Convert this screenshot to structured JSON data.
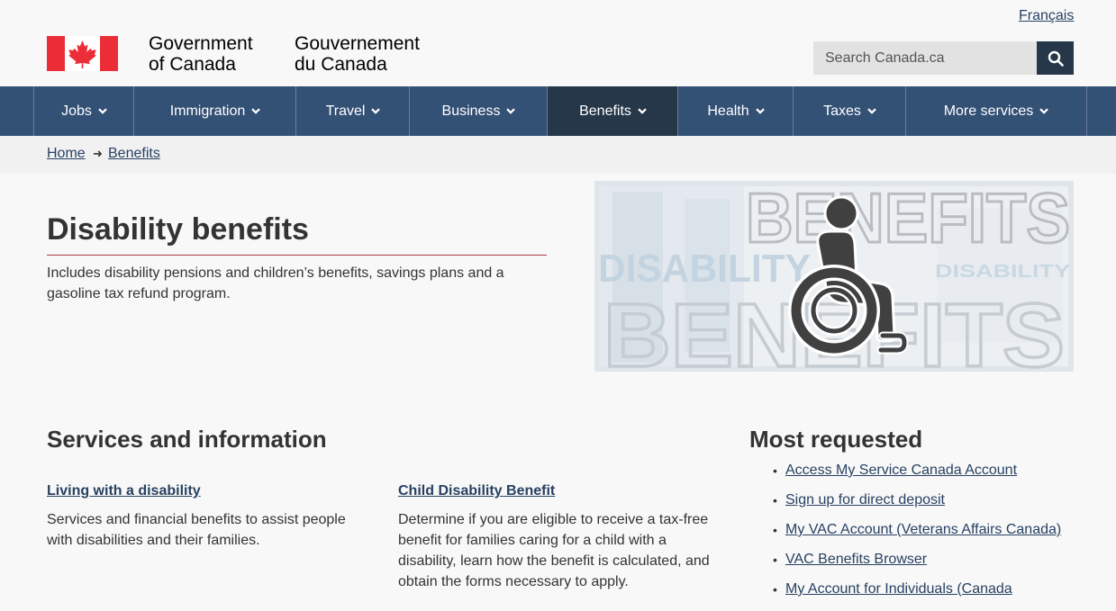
{
  "header": {
    "lang_link": "Français",
    "signature_en_line1": "Government",
    "signature_en_line2": "of Canada",
    "signature_fr_line1": "Gouvernement",
    "signature_fr_line2": "du Canada",
    "search_placeholder": "Search Canada.ca"
  },
  "menu": {
    "items": [
      {
        "label": "Jobs"
      },
      {
        "label": "Immigration"
      },
      {
        "label": "Travel"
      },
      {
        "label": "Business"
      },
      {
        "label": "Benefits"
      },
      {
        "label": "Health"
      },
      {
        "label": "Taxes"
      },
      {
        "label": "More services"
      }
    ],
    "active": "Benefits"
  },
  "breadcrumb": {
    "home": "Home",
    "current": "Benefits"
  },
  "page": {
    "title": "Disability benefits",
    "intro": "Includes disability pensions and children’s benefits, savings plans and a gasoline tax refund program."
  },
  "hero": {
    "text_top": "BENEFITS",
    "text_mid_left": "DISABILITY",
    "text_mid_right": "DISABILITY",
    "text_bottom": "BENEFITS"
  },
  "services": {
    "heading": "Services and information",
    "cards": [
      {
        "title": "Living with a disability",
        "desc": "Services and financial benefits to assist people with disabilities and their families."
      },
      {
        "title": "Child Disability Benefit",
        "desc": "Determine if you are eligible to receive a tax-free benefit for families caring for a child with a disability, learn how the benefit is calculated, and obtain the forms necessary to apply."
      }
    ]
  },
  "most_requested": {
    "heading": "Most requested",
    "items": [
      "Access My Service Canada Account",
      "Sign up for direct deposit",
      "My VAC Account (Veterans Affairs Canada)",
      "VAC Benefits Browser",
      "My Account for Individuals (Canada"
    ]
  },
  "colors": {
    "menu_bg": "#335075",
    "menu_active": "#26374a",
    "link": "#284162",
    "flag_red": "#eb2d37",
    "title_rule": "#af3c43"
  }
}
